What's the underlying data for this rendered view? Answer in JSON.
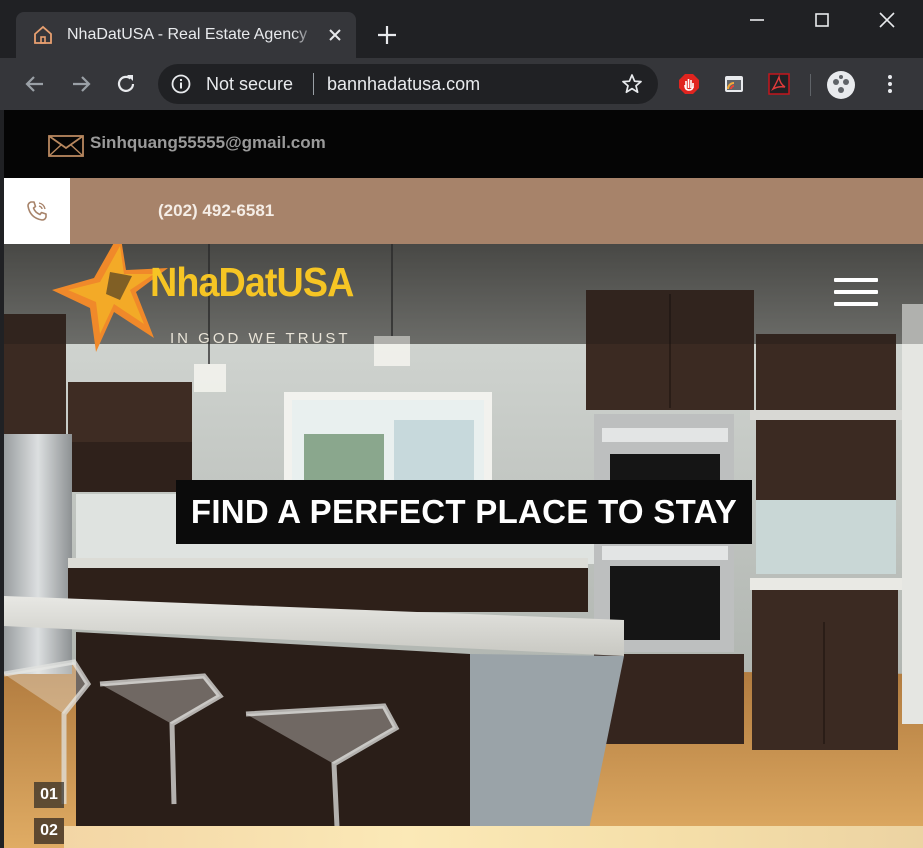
{
  "browser": {
    "tab_title": "NhaDatUSA - Real Estate Agency",
    "security_label": "Not secure",
    "url": "bannhadatusa.com"
  },
  "site": {
    "email": "Sinhquang55555@gmail.com",
    "phone": "(202) 492-6581",
    "logo_name": "NhaDatUSA",
    "logo_tagline": "IN GOD WE TRUST",
    "hero_heading": "FIND A PERFECT PLACE TO STAY",
    "slide_numbers": [
      "01",
      "02"
    ],
    "colors": {
      "phone_bar": "#a7836a",
      "logo_yellow": "#f6c524",
      "logo_star": "#f08a24"
    }
  },
  "icons": {
    "tab_favicon": "house-icon",
    "info": "info-icon",
    "bookmark": "star-icon",
    "email": "envelope-icon",
    "phone": "phone-icon",
    "menu": "hamburger-icon"
  }
}
